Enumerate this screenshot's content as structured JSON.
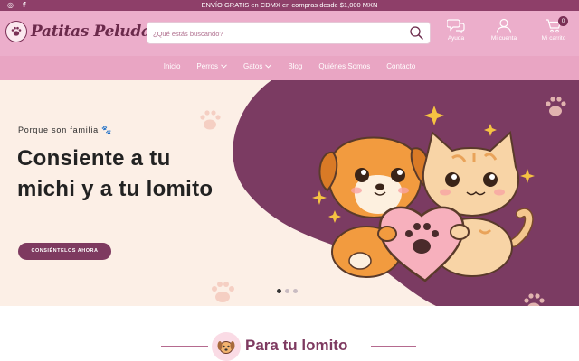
{
  "topbar": {
    "announcement": "ENVÍO GRATIS en CDMX en compras desde $1,000 MXN",
    "social": [
      {
        "icon": "instagram-icon",
        "glyph": "◎"
      },
      {
        "icon": "facebook-icon",
        "glyph": "f"
      }
    ]
  },
  "header": {
    "logo_text": "Patitas Peludas",
    "search_placeholder": "¿Qué estás buscando?",
    "actions": {
      "help": "Ayuda",
      "account": "Mi cuenta",
      "cart": "Mi carrito",
      "cart_count": "0"
    }
  },
  "nav": {
    "items": [
      "Inicio",
      "Perros",
      "Gatos",
      "Blog",
      "Quiénes Somos",
      "Contacto"
    ]
  },
  "hero": {
    "subtitle": "Porque son familia 🐾",
    "headline": "Consiente a tu michi y a tu lomito",
    "cta": "CONSIÉNTELOS AHORA"
  },
  "section": {
    "title": "Para tu lomito"
  },
  "colors": {
    "topbar": "#8e3f69",
    "header": "#ecaecb",
    "nav": "#e9a5c3",
    "accent": "#7e3a60",
    "hero_bg": "#fcefe6"
  }
}
